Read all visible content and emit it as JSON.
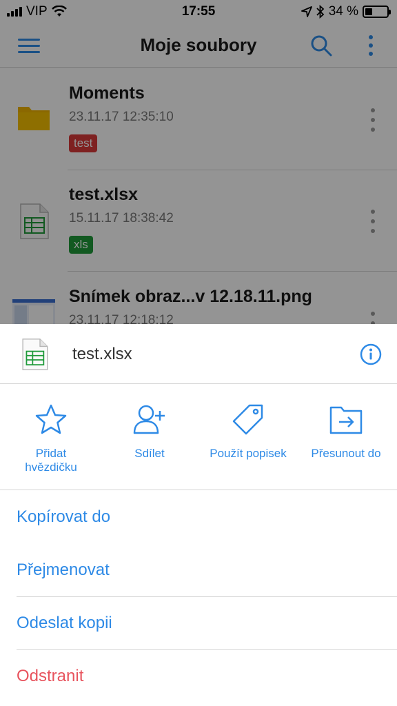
{
  "status_bar": {
    "carrier": "VIP",
    "time": "17:55",
    "battery_percent": "34 %"
  },
  "nav": {
    "title": "Moje soubory",
    "icons": [
      "menu-icon",
      "search-icon",
      "more-icon"
    ],
    "accent": "#2e8ae6"
  },
  "files": [
    {
      "name": "Moments",
      "date": "23.11.17 12:35:10",
      "tag": "test",
      "tag_color": "#d93a3a",
      "icon": "folder-icon"
    },
    {
      "name": "test.xlsx",
      "date": "15.11.17 18:38:42",
      "tag": "xls",
      "tag_color": "#1f9a3a",
      "icon": "spreadsheet-icon"
    },
    {
      "name": "Snímek obraz...v 12.18.11.png",
      "date": "23.11.17 12:18:12",
      "icon": "image-thumbnail"
    }
  ],
  "sheet": {
    "file_name": "test.xlsx",
    "actions": [
      {
        "label": "Přidat hvězdičku",
        "icon": "star-icon"
      },
      {
        "label": "Sdílet",
        "icon": "add-user-icon"
      },
      {
        "label": "Použít popisek",
        "icon": "tag-icon"
      },
      {
        "label": "Přesunout do",
        "icon": "move-folder-icon"
      }
    ],
    "menu": [
      {
        "label": "Kopírovat do"
      },
      {
        "label": "Přejmenovat"
      },
      {
        "label": "Odeslat kopii"
      },
      {
        "label": "Odstranit",
        "color": "#e8545e"
      }
    ]
  }
}
